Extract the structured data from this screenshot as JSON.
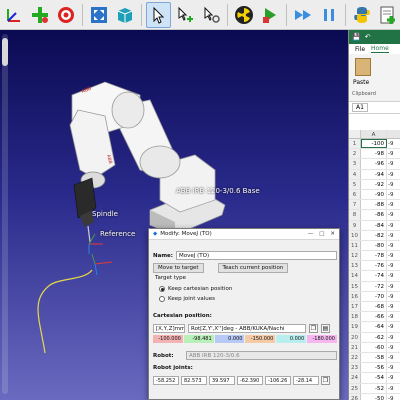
{
  "toolbar": {
    "icons": [
      "frame-icon",
      "add-target-icon",
      "target-icon",
      "fit-view-icon",
      "cube-view-icon",
      "select-icon",
      "move-icon",
      "teach-icon",
      "radiation-icon",
      "play-icon",
      "fast-forward-icon",
      "pause-icon",
      "python-icon",
      "add-program-icon"
    ]
  },
  "viewport": {
    "robot_label": "ABB IRB 120-3/0.6 Base",
    "spindle_label": "Spindle",
    "reference_label": "Reference"
  },
  "excel": {
    "tabs": [
      "File",
      "Home"
    ],
    "paste_label": "Paste",
    "clipboard_label": "Clipboard",
    "name_box": "A1",
    "col_a": "A",
    "rows": [
      {
        "n": "1",
        "a": "-100",
        "b": "-9"
      },
      {
        "n": "2",
        "a": "-98",
        "b": "-9"
      },
      {
        "n": "3",
        "a": "-96",
        "b": "-9"
      },
      {
        "n": "4",
        "a": "-94",
        "b": "-9"
      },
      {
        "n": "5",
        "a": "-92",
        "b": "-9"
      },
      {
        "n": "6",
        "a": "-90",
        "b": "-9"
      },
      {
        "n": "7",
        "a": "-88",
        "b": "-9"
      },
      {
        "n": "8",
        "a": "-86",
        "b": "-9"
      },
      {
        "n": "9",
        "a": "-84",
        "b": "-9"
      },
      {
        "n": "10",
        "a": "-82",
        "b": "-9"
      },
      {
        "n": "11",
        "a": "-80",
        "b": "-9"
      },
      {
        "n": "12",
        "a": "-78",
        "b": "-9"
      },
      {
        "n": "13",
        "a": "-76",
        "b": "-9"
      },
      {
        "n": "14",
        "a": "-74",
        "b": "-9"
      },
      {
        "n": "15",
        "a": "-72",
        "b": "-9"
      },
      {
        "n": "16",
        "a": "-70",
        "b": "-9"
      },
      {
        "n": "17",
        "a": "-68",
        "b": "-9"
      },
      {
        "n": "18",
        "a": "-66",
        "b": "-9"
      },
      {
        "n": "19",
        "a": "-64",
        "b": "-9"
      },
      {
        "n": "20",
        "a": "-62",
        "b": "-9"
      },
      {
        "n": "21",
        "a": "-60",
        "b": "-9"
      },
      {
        "n": "22",
        "a": "-58",
        "b": "-9"
      },
      {
        "n": "23",
        "a": "-56",
        "b": "-9"
      },
      {
        "n": "24",
        "a": "-54",
        "b": "-9"
      },
      {
        "n": "25",
        "a": "-52",
        "b": "-9"
      },
      {
        "n": "26",
        "a": "-50",
        "b": "-9"
      },
      {
        "n": "27",
        "a": "-48",
        "b": "-9"
      }
    ]
  },
  "dialog": {
    "title": "Modify: MoveJ (TO)",
    "name_label": "Name:",
    "name_value": "MoveJ (TO)",
    "move_to_target": "Move to target",
    "teach_current": "Teach current position",
    "target_type": "Target type",
    "keep_cartesian": "Keep cartesian position",
    "keep_joint": "Keep joint values",
    "cartesian_label": "Cartesian position:",
    "format_short": "[X,Y,Z]mm",
    "format_long": "Rot[Z,Y',X'']deg - ABB/KUKA/Nachi",
    "cartesian_values": [
      "-100.000",
      "-98.481",
      "0.000",
      "-150.000",
      "0.000",
      "-180.000"
    ],
    "cartesian_colors": [
      "#f4b3b3",
      "#b9f0b9",
      "#b7c9f7",
      "#f5cba7",
      "#b8eeee",
      "#f6b6f0"
    ],
    "robot_label": "Robot:",
    "robot_value": "ABB IRB 120-3/0.6",
    "joints_label": "Robot joints:",
    "joint_values": [
      "-58.252",
      "82.573",
      "39.597",
      "-62.390",
      "-106.26",
      "-28.14"
    ]
  }
}
